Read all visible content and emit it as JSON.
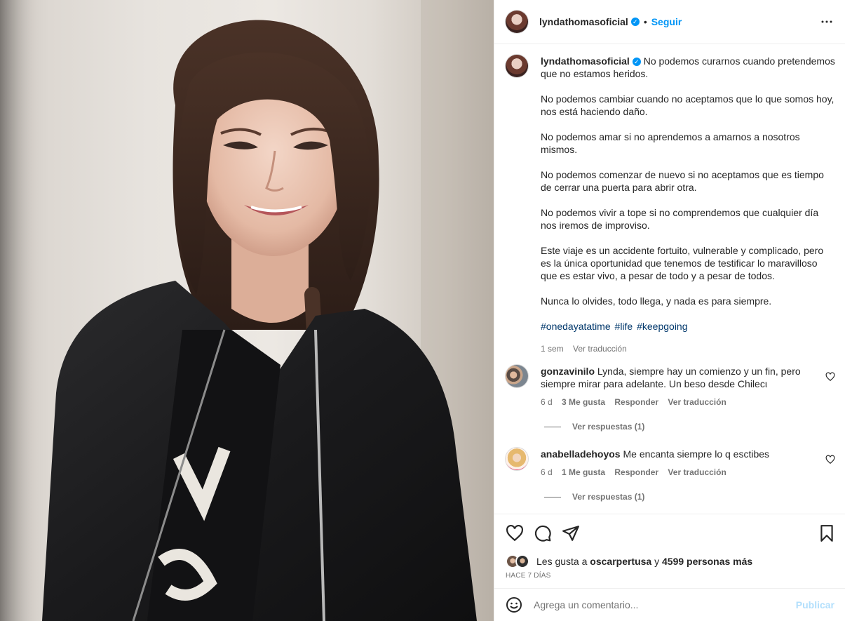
{
  "post": {
    "author": "lyndathomasoficial",
    "follow_label": "Seguir",
    "separator": "•",
    "caption_lead": "No podemos curarnos cuando pretendemos que no estamos heridos.",
    "caption_paragraphs": [
      "No podemos cambiar cuando no aceptamos que lo que somos hoy, nos está haciendo daño.",
      "No podemos amar si no aprendemos a amarnos a nosotros mismos.",
      "No podemos comenzar de nuevo si no aceptamos que es tiempo de cerrar una puerta para abrir otra.",
      "No podemos vivir a tope si no comprendemos que cualquier día nos iremos de improviso.",
      "Este viaje es un accidente fortuito, vulnerable y complicado, pero es la única oportunidad que tenemos de testificar lo maravilloso que es estar vivo, a pesar de todo y a pesar de todos.",
      "Nunca lo olvides, todo llega, y nada es para siempre."
    ],
    "hashtags": [
      "#onedayatatime",
      "#life",
      "#keepgoing"
    ],
    "caption_age": "1 sem",
    "translate_label": "Ver traducción"
  },
  "comments": [
    {
      "user": "gonzavinilo",
      "text": "Lynda, siempre hay un comienzo y un fin, pero siempre mirar para adelante. Un beso desde Chilecι",
      "age": "6 d",
      "likes": "3 Me gusta",
      "reply_label": "Responder",
      "translate_label": "Ver traducción",
      "replies_label": "Ver respuestas (1)"
    },
    {
      "user": "anabelladehoyos",
      "text": "Me encanta siempre lo q esctibes",
      "age": "6 d",
      "likes": "1 Me gusta",
      "reply_label": "Responder",
      "translate_label": "Ver traducción",
      "replies_label": "Ver respuestas (1)"
    }
  ],
  "likes_bar": {
    "prefix": "Les gusta a",
    "user": "oscarpertusa",
    "joiner": "y",
    "others": "4599 personas más",
    "date": "HACE 7 DÍAS"
  },
  "add_comment": {
    "placeholder": "Agrega un comentario...",
    "publish_label": "Publicar"
  },
  "icons": {
    "more": "more-horizontal-icon",
    "like": "heart-icon",
    "comment": "comment-bubble-icon",
    "share": "paper-plane-icon",
    "save": "bookmark-icon",
    "emoji": "emoji-icon",
    "verified": "verified-badge-icon"
  },
  "colors": {
    "accent": "#0095f6",
    "hashtag": "#00376b",
    "muted": "#737373",
    "publish_disabled": "#b2dffc"
  }
}
